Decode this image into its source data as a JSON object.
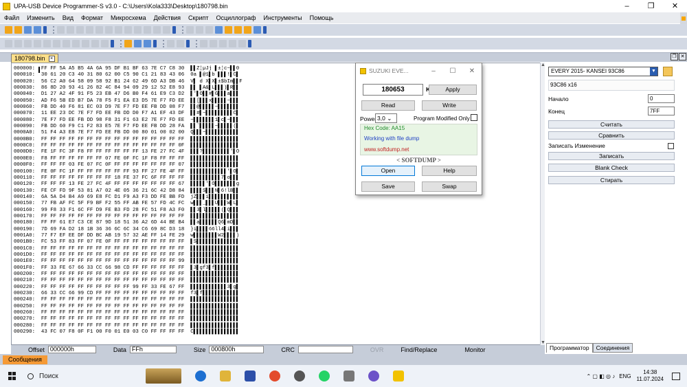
{
  "window": {
    "title": "UPA-USB Device Programmer-S v3.0 - C:\\Users\\Kola333\\Desktop\\180798.bin",
    "controls": [
      "–",
      "❐",
      "✕"
    ]
  },
  "menu": [
    "Файл",
    "Изменить",
    "Вид",
    "Формат",
    "Микросхема",
    "Действия",
    "Скрипт",
    "Осциллограф",
    "Инструменты",
    "Помощь"
  ],
  "document_tab": {
    "label": "180798.bin",
    "close": "×"
  },
  "hex_lines": [
    "000000:  FF FF 5A A5 B5 4A 6A 95 DF B1 BF 63 7E C7 C8 30  ▌▌Z¦µJj ▌±¦c~▌▌0",
    "000010:  30 61 20 C3 40 31 80 62 00 C5 90 C1 21 83 43 06  0a ▌@1▌b ▌▌▌!▌C▌",
    "000020:  56 C2 A0 64 58 09 58 92 B1 24 62 49 6D A3 DB 46  V▌ d X▌X▌±$bIm▌▌F",
    "000030:  86 8D 20 93 41 26 82 4C 84 94 09 29 12 52 E8 93  ▌▌ ▌A&▌L▌▌▌)▌R▌▌",
    "000040:  D1 27 A2 4F 91 F5 23 EB 47 D6 B0 F4 61 E9 C3 D2  ▌'▌O▌▌#▌G▌▌▌a▌▌▌",
    "000050:  AD F6 5B ED B7 DA 78 F5 F1 EA E3 D5 7E F7 FD EE  ▌▌[▌▌▌x▌▌▌▌▌~▌▌▌",
    "000060:  FB DD 40 F6 81 EC 03 D9 7E F7 FD EE FB DD 08 F7  ▌▌@▌▌▌▌▌~▌▌▌▌▌▌▌",
    "000070:  11 EE 23 DC 7E F7 FD EE FB DD D0 F7 A1 EF 43 DF  ▌▌#▌~▌▌▌▌▌▌▌▌▌C▌",
    "000080:  7E F7 FD EE FB DD 98 F8 31 F1 63 E2 7E F7 FD EE  ~▌▌▌▌▌▌▌1▌c▌~▌▌▌",
    "000090:  FB DD 60 F9 C1 F2 83 E5 7E F7 FD EE FB DD 28 FA  ▌▌`▌▌▌▌▌~▌▌▌▌▌(▌",
    "0000A0:  51 F4 A3 E8 7E F7 FD EE FB DD 00 80 01 00 02 00  Q▌▌▌~▌▌▌▌▌▌▌▌▌▌▌",
    "0000B0:  FF FF FF FF FF FF FF FF FF FF FF FF FF FF FF FF  ▌▌▌▌▌▌▌▌▌▌▌▌▌▌▌▌",
    "0000C0:  FF FF FF FF FF FF FF FF FF FF FF FF FF FF FF 0F  ▌▌▌▌▌▌▌▌▌▌▌▌▌▌▌▌",
    "0000D0:  FE 1F FC 3F F8 FF FF FF FF FF FF 13 FE 27 FC 4F  ▌▌▌?▌▌▌▌▌▌▌▌▌'▌O",
    "0000E0:  F8 FF FF FF FF FF FF 07 FE 0F FC 1F F8 FF FF FF  ▌▌▌▌▌▌▌▌▌▌▌▌▌▌▌▌",
    "0000F0:  FF FF FF 03 FE 07 FC 0F FF FF FF FF FF FF FF 07  ▌▌▌▌▌▌▌▌▌▌▌▌▌▌▌▌",
    "000100:  FE 0F FC 1F FF FF FF FF FF FF 93 FF 27 FE 4F FF  ▌▌▌▌▌▌▌▌▌▌▌▌'▌O▌",
    "000110:  FF FF FF FF FF FF FF FF 18 FE 37 FC 6F FF FF FF  ▌▌▌▌▌▌▌▌▌▌7▌o▌▌▌",
    "000120:  FF FF FF 13 FE 27 FC 4F FF FF FF FF FF FF FF 67  ▌▌▌▌▌'▌O▌▌▌▌▌▌▌g",
    "000130:  FE CF FD 9F 53 81 A7 02 4E 05 36 21 6C 42 D8 84  ▌▌▌▌S▌▌▌N▌6!lB▌▌",
    "000140:  6A 5A D4 B4 A9 69 E8 FC D1 F9 A3 F3 DD FE BB FD  jZ▌▌▌i▌▌▌▌▌▌▌▌▌▌",
    "000150:  77 FB AF FC 5F F9 BF F2 55 FF AB FE 57 FD 4C FC  w▌▌▌_▌▌▌U▌▌▌W▌L▌",
    "000160:  99 F8 33 F1 6C FF D9 FE B3 FD 28 FC 51 F8 A3 F0  ▌▌3▌l▌▌▌▌▌(▌Q▌▌▌",
    "000170:  FF FF FF FF FF FF FF FF FF FF FF FF FF FF FF FF  ▌▌▌▌▌▌▌▌▌▌▌▌▌▌▌▌",
    "000180:  FF FF 61 E7 C3 CE 87 9D 18 51 36 A2 6D 44 BE B4  ▌▌a▌▌▌▌▌▌Q6▌mD▌▌",
    "000190:  7D 69 FA D2 18 1B 36 36 6C 6C 34 C6 69 8C D3 18  }i▌▌▌▌66ll4▌i▌▌▌",
    "0001A0:  77 F7 EF EE DF DD BC AB 19 57 32 AE FF 14 FE 29  w▌▌▌▌▌▌▌▌W2▌▌▌▌)",
    "0001B0:  FC 53 FF 83 FF 07 FE 0F FF FF FF FF FF FF FF FF  ▌S▌▌▌▌▌▌▌▌▌▌▌▌▌▌",
    "0001C0:  FF FF FF FF FF FF FF FF FF FF FF FF FF FF FF FF  ▌▌▌▌▌▌▌▌▌▌▌▌▌▌▌▌",
    "0001D0:  FF FF FF FF FF FF FF FF FF FF FF FF FF FF FF FF  ▌▌▌▌▌▌▌▌▌▌▌▌▌▌▌▌",
    "0001E0:  FF FF FF FF FF FF FF FF FF FF FF FF FF FF FF 99  ▌▌▌▌▌▌▌▌▌▌▌▌▌▌▌▌",
    "0001F0:  FF 33 FE 67 66 33 CC 66 98 CD FF FF FF FF FF FF  ▌3▌gf3▌f▌▌▌▌▌▌▌▌",
    "000200:  FF FF FF FF FF FF FF FF FF FF FF FF FF FF FF FF  ▌▌▌▌▌▌▌▌▌▌▌▌▌▌▌▌",
    "000210:  FF FF FF FF FF FF FF FF FF FF FF FF FF FF FF FF  ▌▌▌▌▌▌▌▌▌▌▌▌▌▌▌▌",
    "000220:  FF FF FF FF FF FF FF FF FF FF 99 FF 33 FE 67 FF  ▌▌▌▌▌▌▌▌▌▌▌▌3▌g▌",
    "000230:  66 33 CC 66 99 CD FF FF FF FF FF FF FF FF FF FF  f3▌f▌▌▌▌▌▌▌▌▌▌▌▌",
    "000240:  FF FF FF FF FF FF FF FF FF FF FF FF FF FF FF FF  ▌▌▌▌▌▌▌▌▌▌▌▌▌▌▌▌",
    "000250:  FF FF FF FF FF FF FF FF FF FF FF FF FF FF FF FF  ▌▌▌▌▌▌▌▌▌▌▌▌▌▌▌▌",
    "000260:  FF FF FF FF FF FF FF FF FF FF FF FF FF FF FF FF  ▌▌▌▌▌▌▌▌▌▌▌▌▌▌▌▌",
    "000270:  FF FF FF FF FF FF FF FF FF FF FF FF FF FF FF FF  ▌▌▌▌▌▌▌▌▌▌▌▌▌▌▌▌",
    "000280:  FF FF FF FF FF FF FF FF FF FF FF FF FF FF FF FF  ▌▌▌▌▌▌▌▌▌▌▌▌▌▌▌▌",
    "000290:  43 FC 07 F8 0F F1 00 F0 01 E0 03 C0 FF FF FF FF  C▌▌▌▌▌▌▌▌▌▌▌▌▌▌▌"
  ],
  "statusbar": {
    "offset_label": "Offset",
    "offset_value": "000000h",
    "data_label": "Data",
    "data_value": "FFh",
    "size_label": "Size",
    "size_value": "000800h",
    "crc_label": "CRC",
    "ovr": "OVR",
    "find_replace": "Find/Replace",
    "monitor": "Monitor"
  },
  "side": {
    "device": "EVERY 2015- KANSEI 93C86",
    "chip": "93C86 x16",
    "start_label": "Начало",
    "start_value": "0",
    "end_label": "Конец",
    "end_value": "7FF",
    "read": "Считать",
    "compare": "Сравнить",
    "write_change": "Записать Изменение",
    "write": "Записать",
    "blank_check": "Blank Check",
    "erase": "Стирать",
    "tab_programmer": "Программатор",
    "tab_connections": "Соединения"
  },
  "dialog": {
    "title": "SUZUKI EVE...",
    "km_value": "180653",
    "km_label": "Km",
    "apply": "Apply",
    "read": "Read",
    "write": "Write",
    "power_label": "Power",
    "power_value": "3,0",
    "program_modified": "Program Modified Only",
    "hex_code": "Hex Code: AA15",
    "working": "Working with file dump",
    "site": "www.softdump.net",
    "brand": "< SOFTDUMP >",
    "open": "Open",
    "help": "Help",
    "save": "Save",
    "swap": "Swap"
  },
  "bottom_tab": "Сообщения",
  "taskbar": {
    "search": "Поиск",
    "lang": "ENG",
    "time": "14:38",
    "date": "11.07.2024"
  },
  "colors": {
    "menu_bg": "#e9ebef",
    "toolbar_bg": "#d3d9e4",
    "tab_active": "#ffe08a",
    "messages_tab": "#f59a36",
    "dialog_green_text": "#1f8b2a",
    "dialog_blue_text": "#1d3fc4",
    "dialog_red_text": "#c02020"
  }
}
